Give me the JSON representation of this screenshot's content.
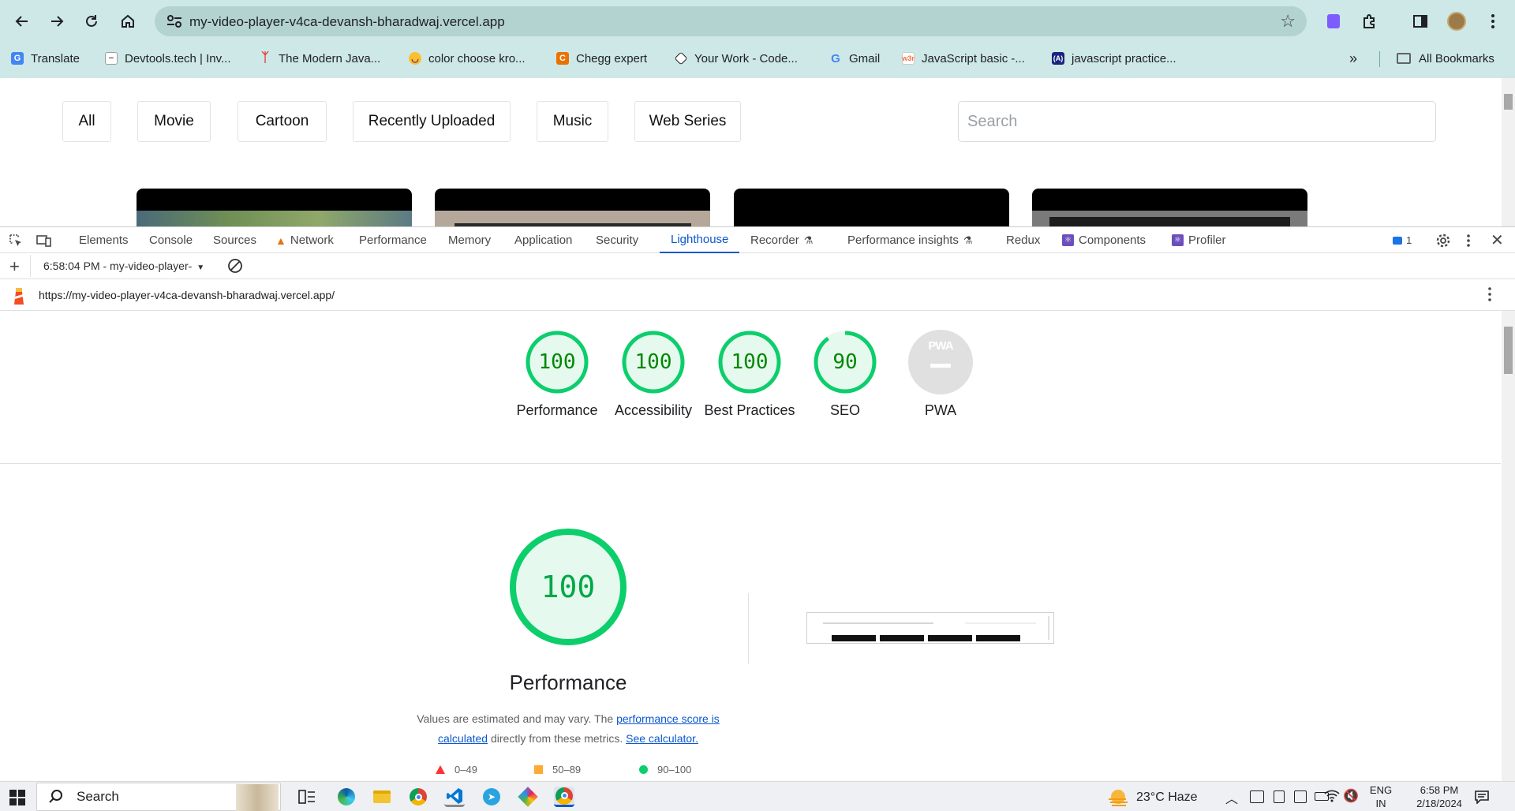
{
  "browser": {
    "url": "my-video-player-v4ca-devansh-bharadwaj.vercel.app",
    "bookmarks": [
      {
        "label": "Translate",
        "icon": "google-translate-icon",
        "color": "#4285f4"
      },
      {
        "label": "Devtools.tech | Inv...",
        "icon": "devtools-tech-icon",
        "color": "#9e9e9e"
      },
      {
        "label": "The Modern Java...",
        "icon": "modern-js-icon",
        "color": "#e53935"
      },
      {
        "label": "color choose kro...",
        "icon": "color-icon",
        "color": "#fbc02d"
      },
      {
        "label": "Chegg expert",
        "icon": "chegg-icon",
        "color": "#eb7100"
      },
      {
        "label": "Your Work - Code...",
        "icon": "codepen-icon",
        "color": "#202124"
      },
      {
        "label": "Gmail",
        "icon": "google-icon",
        "color": "#4285f4"
      },
      {
        "label": "JavaScript basic -...",
        "icon": "w3r-icon",
        "color": "#ff7043"
      },
      {
        "label": "javascript practice...",
        "icon": "practice-icon",
        "color": "#1a237e"
      }
    ],
    "all_bookmarks": "All Bookmarks"
  },
  "page": {
    "filters": [
      "All",
      "Movie",
      "Cartoon",
      "Recently Uploaded",
      "Music",
      "Web Series"
    ],
    "search_placeholder": "Search"
  },
  "devtools": {
    "tabs": [
      "Elements",
      "Console",
      "Sources",
      "Network",
      "Performance",
      "Memory",
      "Application",
      "Security",
      "Lighthouse",
      "Recorder",
      "Performance insights",
      "Redux",
      "Components",
      "Profiler"
    ],
    "active_tab": "Lighthouse",
    "issues_count": "1",
    "report_select": "6:58:04 PM - my-video-player-",
    "report_url": "https://my-video-player-v4ca-devansh-bharadwaj.vercel.app/"
  },
  "lighthouse": {
    "scores": [
      {
        "label": "Performance",
        "value": "100",
        "fraction": 1.0
      },
      {
        "label": "Accessibility",
        "value": "100",
        "fraction": 1.0
      },
      {
        "label": "Best Practices",
        "value": "100",
        "fraction": 1.0
      },
      {
        "label": "SEO",
        "value": "90",
        "fraction": 0.9
      }
    ],
    "pwa": {
      "label": "PWA",
      "badge": "PWA"
    },
    "main_score": "100",
    "main_title": "Performance",
    "desc_1": "Values are estimated and may vary. The ",
    "desc_link_1": "performance score is calculated",
    "desc_2": " directly from these metrics. ",
    "desc_link_2": "See calculator.",
    "legend": [
      {
        "range": "0–49",
        "color": "#ff3333"
      },
      {
        "range": "50–89",
        "color": "#ffaa33"
      },
      {
        "range": "90–100",
        "color": "#0cce6b"
      }
    ]
  },
  "taskbar": {
    "search": "Search",
    "weather": "23°C  Haze",
    "lang_1": "ENG",
    "lang_2": "IN",
    "time": "6:58 PM",
    "date": "2/18/2024"
  }
}
